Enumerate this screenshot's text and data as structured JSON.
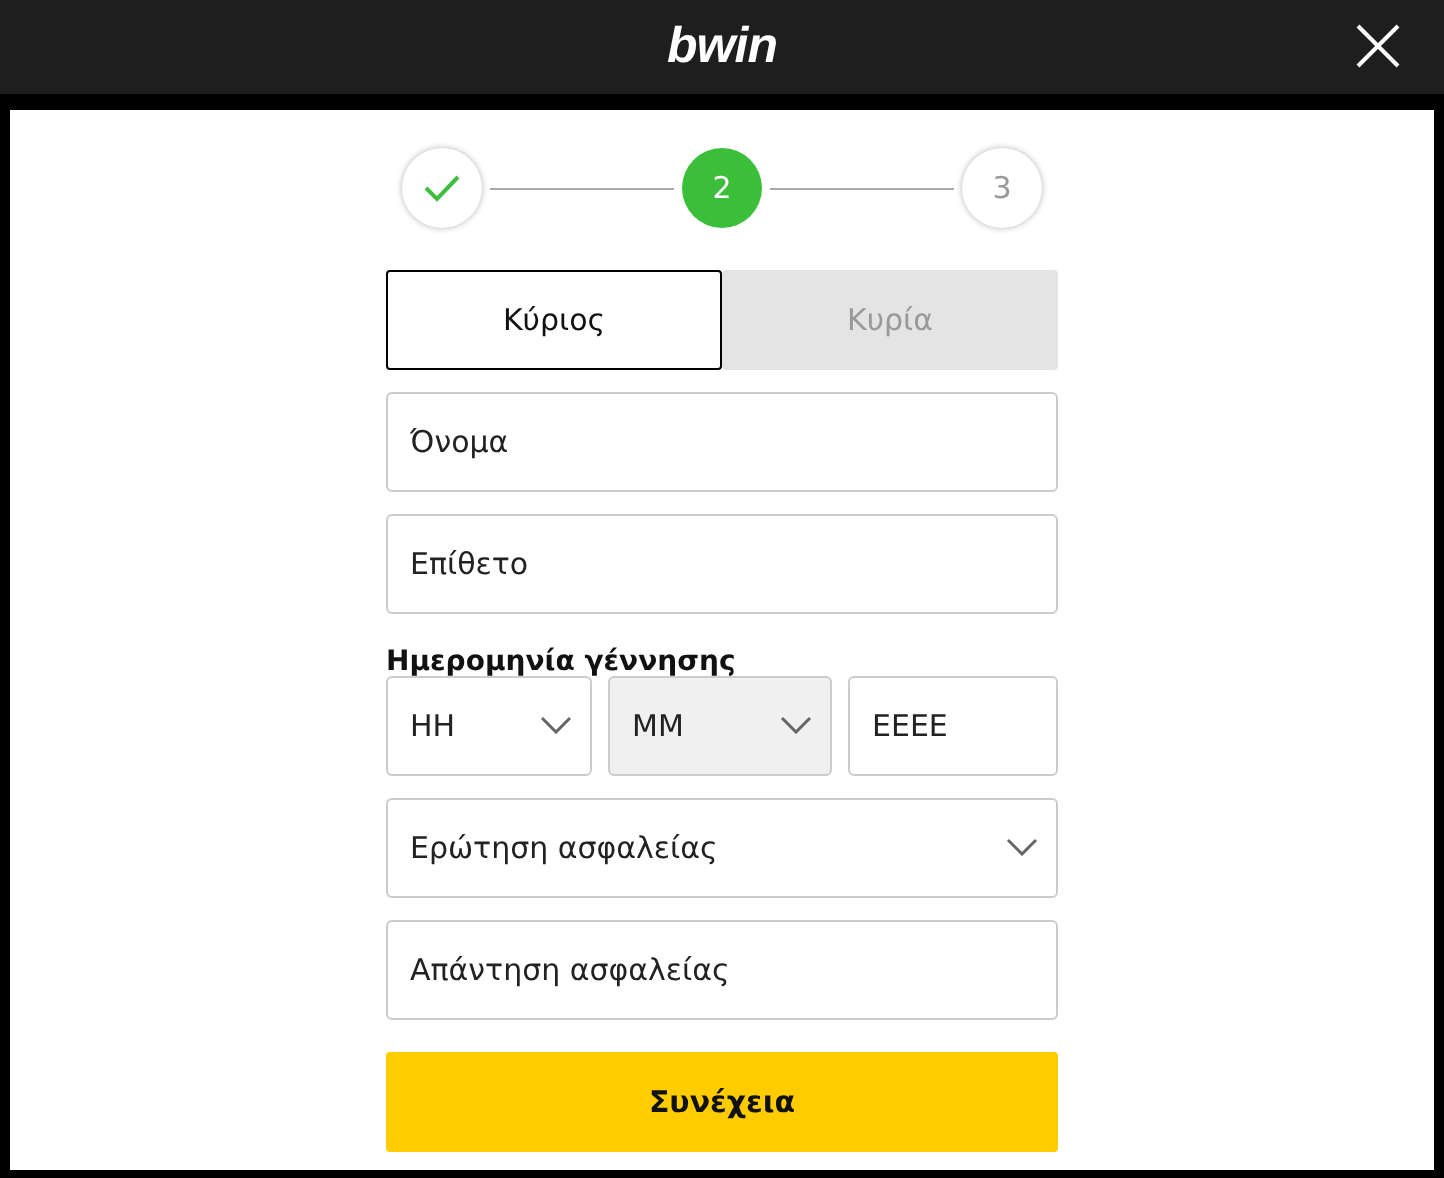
{
  "header": {
    "logo": "bwin"
  },
  "steps": [
    {
      "kind": "done"
    },
    {
      "kind": "current",
      "label": "2"
    },
    {
      "kind": "upcoming",
      "label": "3"
    }
  ],
  "title_options": [
    {
      "label": "Κύριος",
      "selected": true
    },
    {
      "label": "Κυρία",
      "selected": false
    }
  ],
  "fields_top": [
    {
      "kind": "text",
      "placeholder": "Όνομα"
    },
    {
      "kind": "text",
      "placeholder": "Επίθετο"
    }
  ],
  "birth_date": {
    "label": "Ημερομηνία γέννησης",
    "parts": [
      {
        "kind": "select",
        "placeholder": "ΗΗ",
        "hovered": false
      },
      {
        "kind": "select",
        "placeholder": "ΜΜ",
        "hovered": true
      },
      {
        "kind": "text",
        "placeholder": "ΕΕΕΕ",
        "hovered": false
      }
    ]
  },
  "fields_bottom": [
    {
      "kind": "select",
      "placeholder": "Ερώτηση ασφαλείας"
    },
    {
      "kind": "text",
      "placeholder": "Απάντηση ασφαλείας"
    }
  ],
  "continue_button": "Συνέχεια"
}
